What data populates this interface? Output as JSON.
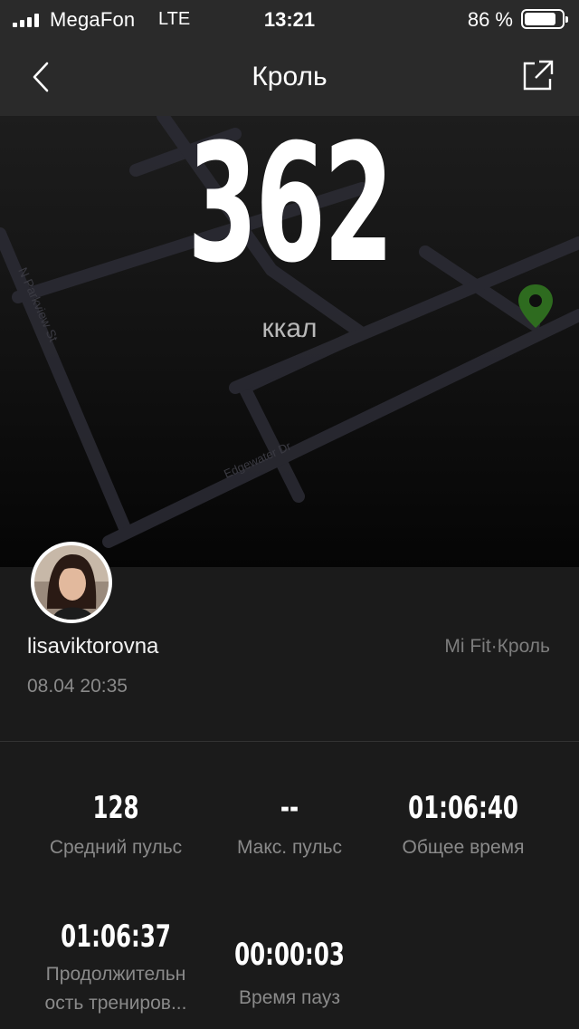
{
  "status_bar": {
    "carrier": "MegaFon",
    "network": "LTE",
    "time": "13:21",
    "battery_percent": "86 %",
    "battery_level": 0.86
  },
  "nav": {
    "title": "Кроль",
    "back_icon": "chevron-left-icon",
    "share_icon": "share-external-icon"
  },
  "map": {
    "calories": "362",
    "calories_unit": "ккал",
    "street_labels": [
      "N Parkview St",
      "Edgewater Dr"
    ]
  },
  "profile": {
    "username": "lisaviktorovna",
    "source": "Mi Fit·Кроль",
    "datetime": "08.04 20:35"
  },
  "stats": [
    {
      "value": "128",
      "label": "Средний пульс"
    },
    {
      "value": "--",
      "label": "Макс. пульс"
    },
    {
      "value": "01:06:40",
      "label": "Общее время"
    },
    {
      "value": "01:06:37",
      "label": "Продолжительн\nость трениров..."
    },
    {
      "value": "00:00:03",
      "label": "Время пауз"
    }
  ],
  "colors": {
    "background": "#1b1b1b",
    "header": "#2a2a2a",
    "pin": "#2e6b1f",
    "muted_text": "#8a8a8a"
  }
}
